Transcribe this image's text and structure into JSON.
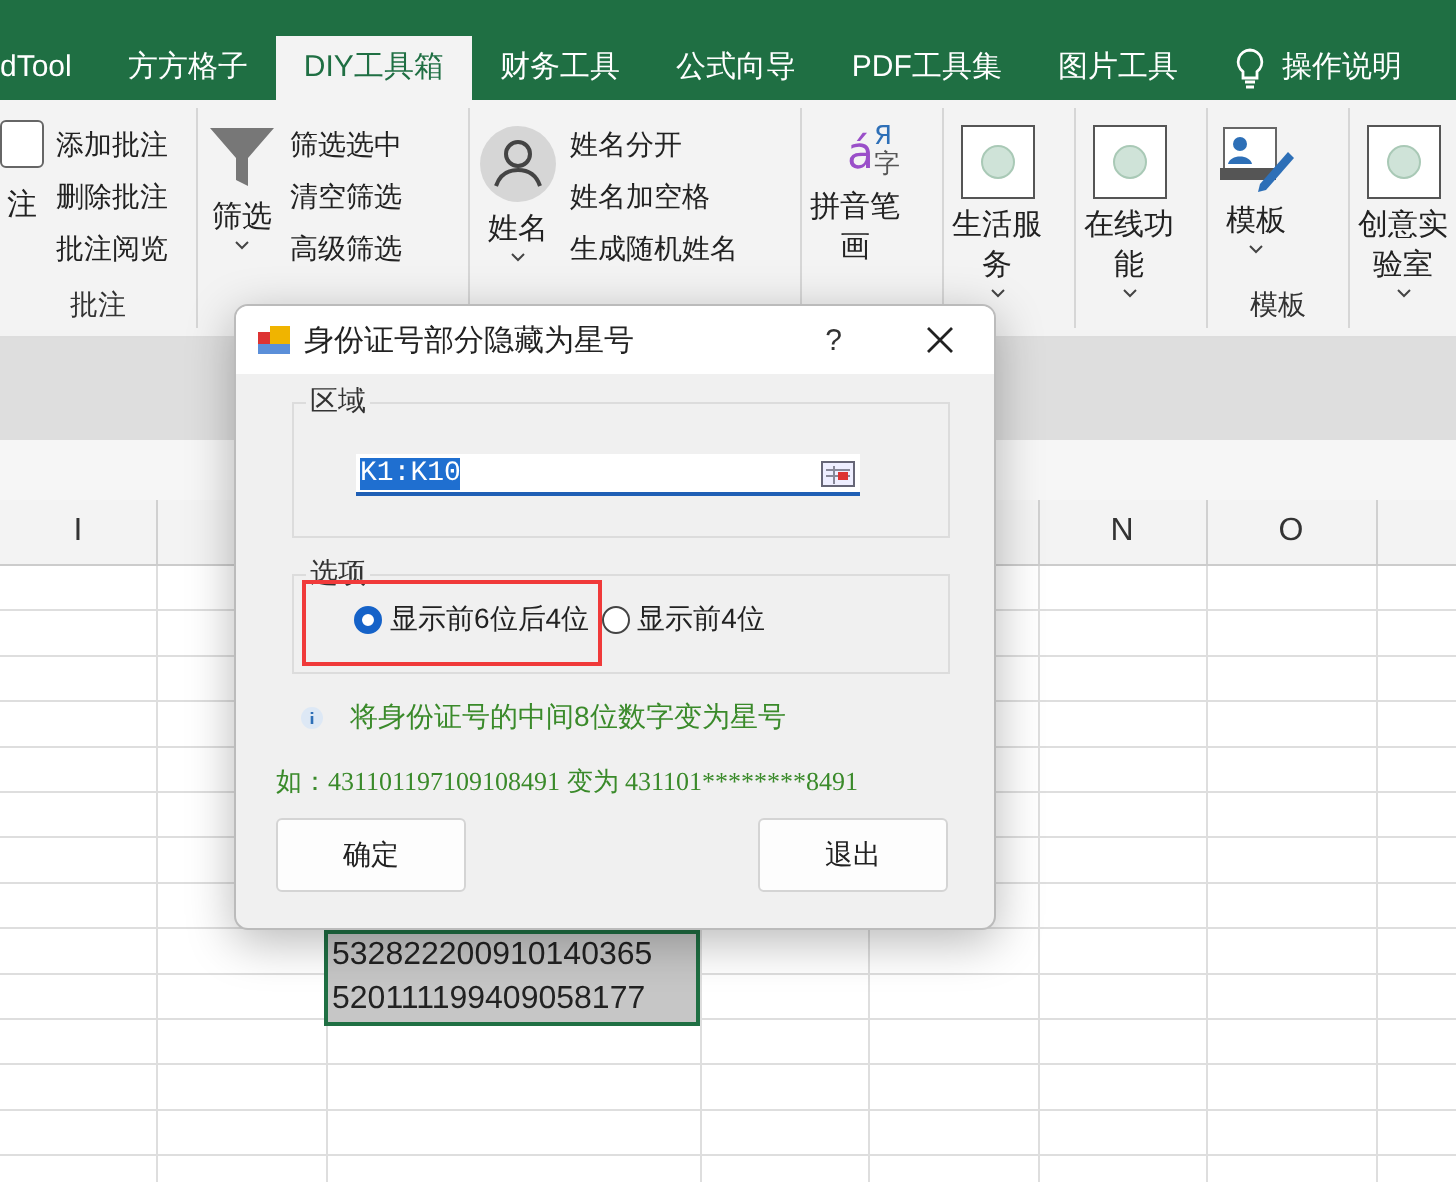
{
  "tabs": [
    {
      "label": "dTool",
      "selected": false
    },
    {
      "label": "方方格子",
      "selected": false
    },
    {
      "label": "DIY工具箱",
      "selected": true
    },
    {
      "label": "财务工具",
      "selected": false
    },
    {
      "label": "公式向导",
      "selected": false
    },
    {
      "label": "PDF工具集",
      "selected": false
    },
    {
      "label": "图片工具",
      "selected": false
    }
  ],
  "tell_me": {
    "label": "操作说明"
  },
  "ribbon": [
    {
      "kind": "comments",
      "big_lines": [
        "注"
      ],
      "items": [
        "添加批注",
        "删除批注",
        "批注阅览"
      ],
      "label": "批注"
    },
    {
      "kind": "filter",
      "big_lines": [
        "筛选"
      ],
      "items": [
        "筛选选中",
        "清空筛选",
        "高级筛选"
      ]
    },
    {
      "kind": "name",
      "big_lines": [
        "姓名"
      ],
      "items": [
        "姓名分开",
        "姓名加空格",
        "生成随机姓名"
      ]
    },
    {
      "kind": "pinyin",
      "icon_glyphs": [
        "á",
        "Я",
        "字"
      ],
      "big_lines": [
        "拼音笔",
        "画"
      ]
    },
    {
      "kind": "frame",
      "big_lines": [
        "生活服",
        "务"
      ]
    },
    {
      "kind": "frame",
      "big_lines": [
        "在线功",
        "能"
      ]
    },
    {
      "kind": "template",
      "big_lines": [
        "模板"
      ],
      "label": "模板"
    },
    {
      "kind": "frame",
      "big_lines": [
        "创意实",
        "验室"
      ]
    }
  ],
  "sheet": {
    "column_headers": [
      {
        "label": "I"
      },
      {
        "label": "N"
      },
      {
        "label": "O"
      }
    ],
    "cells": [
      {
        "text": "532822200910140365"
      },
      {
        "text": "520111199409058177"
      }
    ]
  },
  "dialog": {
    "title": "身份证号部分隐藏为星号",
    "help": "?",
    "region": {
      "legend": "区域",
      "value": "K1:K10"
    },
    "options": {
      "legend": "选项",
      "radios": [
        {
          "label": "显示前6位后4位",
          "selected": true
        },
        {
          "label": "显示前4位",
          "selected": false
        }
      ]
    },
    "info": "将身份证号的中间8位数字变为星号",
    "example": "如：431101197109108491 变为 431101********8491",
    "buttons": [
      "确定",
      "退出"
    ]
  }
}
